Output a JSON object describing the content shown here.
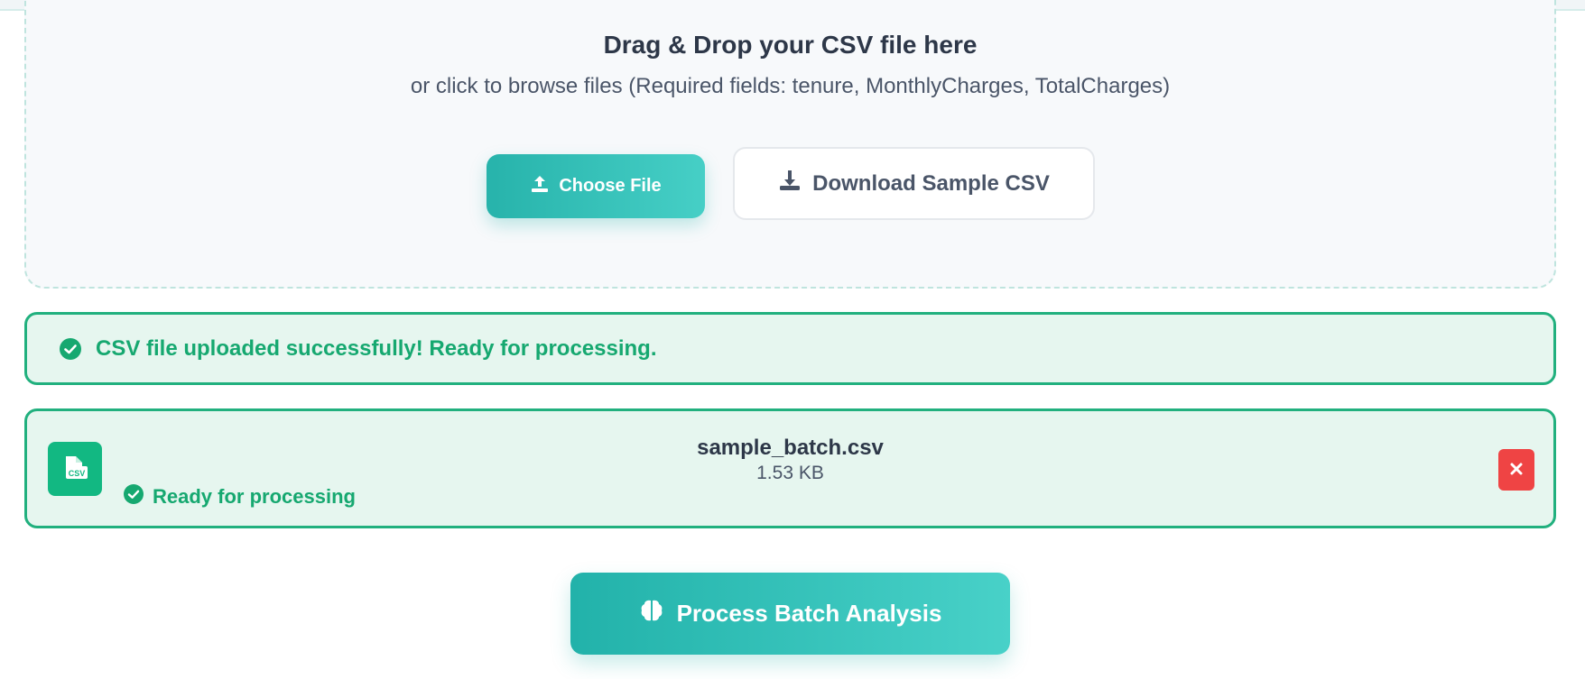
{
  "upload": {
    "title": "Drag & Drop your CSV file here",
    "subtitle": "or click to browse files (Required fields: tenure, MonthlyCharges, TotalCharges)",
    "choose_label": "Choose File",
    "choose_icon": "upload-icon",
    "download_label": "Download Sample CSV",
    "download_icon": "download-icon"
  },
  "alert": {
    "icon": "check-circle-icon",
    "message": "CSV file uploaded successfully! Ready for processing."
  },
  "file": {
    "type_icon": "csv-file-icon",
    "type_label": "CSV",
    "name": "sample_batch.csv",
    "size": "1.53 KB",
    "status": "Ready for processing",
    "status_icon": "check-circle-icon",
    "remove_icon": "close-icon"
  },
  "process": {
    "label": "Process Batch Analysis",
    "icon": "brain-icon"
  },
  "colors": {
    "accent": "#27b3ab",
    "success": "#16a870",
    "danger": "#ef4444"
  }
}
